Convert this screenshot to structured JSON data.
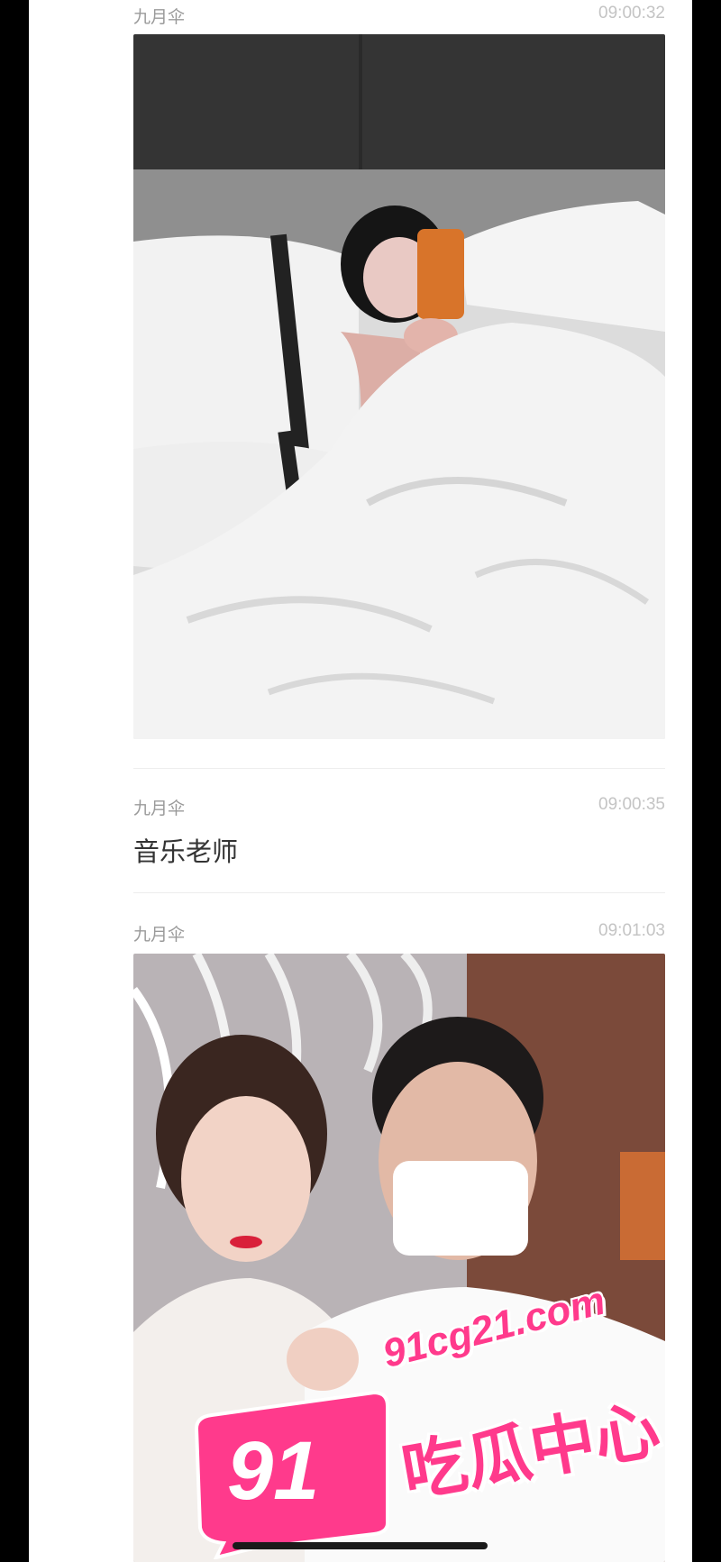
{
  "messages": [
    {
      "sender": "九月伞",
      "time": "09:00:32",
      "type": "image",
      "image_desc": "bed-selfie"
    },
    {
      "sender": "九月伞",
      "time": "09:00:35",
      "type": "text",
      "text": "音乐老师"
    },
    {
      "sender": "九月伞",
      "time": "09:01:03",
      "type": "image",
      "image_desc": "couple-selfie"
    }
  ],
  "watermark": {
    "badge": "91",
    "domain": "91cg21.com",
    "name": "吃瓜中心",
    "color": "#ff3a8c"
  }
}
